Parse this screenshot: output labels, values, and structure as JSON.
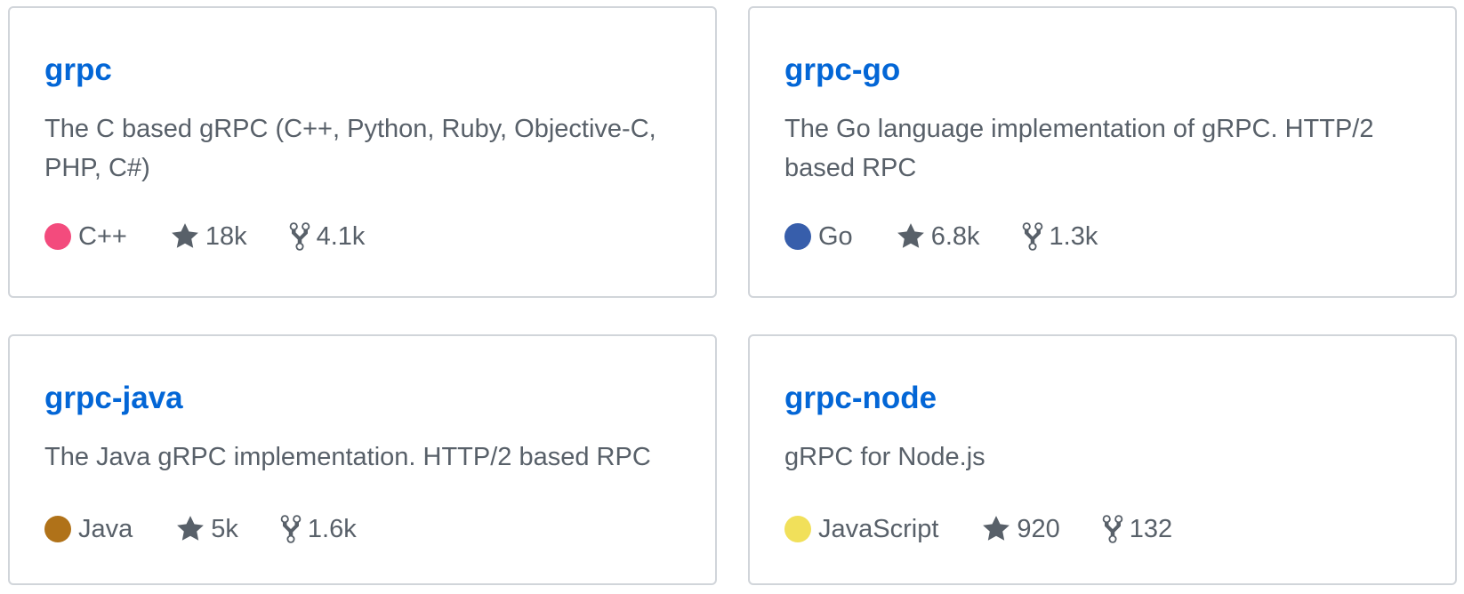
{
  "repos": [
    {
      "name": "grpc",
      "description": "The C based gRPC (C++, Python, Ruby, Objective-C, PHP, C#)",
      "language": "C++",
      "language_color": "#f34b7d",
      "stars": "18k",
      "forks": "4.1k"
    },
    {
      "name": "grpc-go",
      "description": "The Go language implementation of gRPC. HTTP/2 based RPC",
      "language": "Go",
      "language_color": "#375eab",
      "stars": "6.8k",
      "forks": "1.3k"
    },
    {
      "name": "grpc-java",
      "description": "The Java gRPC implementation. HTTP/2 based RPC",
      "language": "Java",
      "language_color": "#b07219",
      "stars": "5k",
      "forks": "1.6k"
    },
    {
      "name": "grpc-node",
      "description": "gRPC for Node.js",
      "language": "JavaScript",
      "language_color": "#f1e05a",
      "stars": "920",
      "forks": "132"
    }
  ],
  "icons": {
    "star": "star-icon",
    "fork": "fork-icon"
  },
  "colors": {
    "link": "#0366d6",
    "text": "#586069",
    "border": "#d1d5da"
  }
}
